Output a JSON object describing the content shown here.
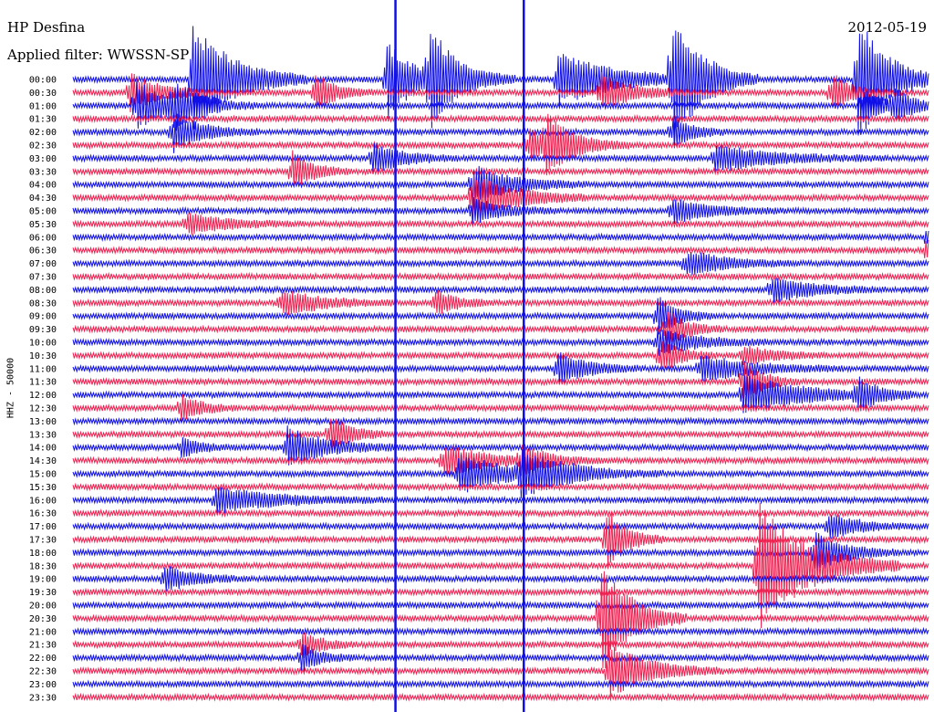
{
  "header": {
    "station": "HP Desfina",
    "filter": "Applied filter: WWSSN-SP",
    "date": "2012-05-19",
    "channel": "HHZ - 50000"
  },
  "chart_data": {
    "type": "helicorder",
    "title": "HP Desfina",
    "subtitle": "Applied filter: WWSSN-SP",
    "date": "2012-05-19",
    "ylabel": "HHZ - 50000",
    "row_interval_minutes": 30,
    "series_colors": [
      "#1010e6",
      "#ee2050"
    ],
    "rows": [
      "00:00",
      "00:30",
      "01:00",
      "01:30",
      "02:00",
      "02:30",
      "03:00",
      "03:30",
      "04:00",
      "04:30",
      "05:00",
      "05:30",
      "06:00",
      "06:30",
      "07:00",
      "07:30",
      "08:00",
      "08:30",
      "09:00",
      "09:30",
      "10:00",
      "10:30",
      "11:00",
      "11:30",
      "12:00",
      "12:30",
      "13:00",
      "13:30",
      "14:00",
      "14:30",
      "15:00",
      "15:30",
      "16:00",
      "16:30",
      "17:00",
      "17:30",
      "18:00",
      "18:30",
      "19:00",
      "19:30",
      "20:00",
      "20:30",
      "21:00",
      "21:30",
      "22:00",
      "22:30",
      "23:00",
      "23:30"
    ],
    "events": [
      {
        "row": "00:00",
        "minute": 4.2,
        "amplitude": 9,
        "duration": 4
      },
      {
        "row": "00:00",
        "minute": 11,
        "amplitude": 6,
        "duration": 3
      },
      {
        "row": "00:00",
        "minute": 12.5,
        "amplitude": 7,
        "duration": 3
      },
      {
        "row": "00:00",
        "minute": 21,
        "amplitude": 10,
        "duration": 3
      },
      {
        "row": "00:00",
        "minute": 17,
        "amplitude": 4,
        "duration": 6
      },
      {
        "row": "00:00",
        "minute": 27.5,
        "amplitude": 10,
        "duration": 3
      },
      {
        "row": "00:30",
        "minute": 2,
        "amplitude": 3,
        "duration": 3
      },
      {
        "row": "00:30",
        "minute": 8.5,
        "amplitude": 3,
        "duration": 2
      },
      {
        "row": "00:30",
        "minute": 18.5,
        "amplitude": 3,
        "duration": 3
      },
      {
        "row": "00:30",
        "minute": 26.6,
        "amplitude": 3,
        "duration": 2
      },
      {
        "row": "01:00",
        "minute": 2.2,
        "amplitude": 4,
        "duration": 3
      },
      {
        "row": "01:00",
        "minute": 3.5,
        "amplitude": 3,
        "duration": 3
      },
      {
        "row": "01:00",
        "minute": 27.7,
        "amplitude": 3,
        "duration": 2
      },
      {
        "row": "01:00",
        "minute": 28.8,
        "amplitude": 2.5,
        "duration": 2
      },
      {
        "row": "02:00",
        "minute": 3.5,
        "amplitude": 3,
        "duration": 3
      },
      {
        "row": "02:00",
        "minute": 21,
        "amplitude": 2.5,
        "duration": 2
      },
      {
        "row": "02:30",
        "minute": 16,
        "amplitude": 3,
        "duration": 2
      },
      {
        "row": "02:30",
        "minute": 16.6,
        "amplitude": 4,
        "duration": 3
      },
      {
        "row": "03:00",
        "minute": 10.5,
        "amplitude": 2.5,
        "duration": 3
      },
      {
        "row": "03:00",
        "minute": 22.5,
        "amplitude": 2,
        "duration": 6
      },
      {
        "row": "03:30",
        "minute": 7.7,
        "amplitude": 3,
        "duration": 2
      },
      {
        "row": "04:00",
        "minute": 14,
        "amplitude": 3,
        "duration": 4
      },
      {
        "row": "04:30",
        "minute": 14,
        "amplitude": 4,
        "duration": 4
      },
      {
        "row": "05:00",
        "minute": 14,
        "amplitude": 2,
        "duration": 3
      },
      {
        "row": "05:00",
        "minute": 21,
        "amplitude": 1.8,
        "duration": 4
      },
      {
        "row": "05:30",
        "minute": 4,
        "amplitude": 1.6,
        "duration": 4
      },
      {
        "row": "06:00",
        "minute": 30,
        "amplitude": 2.5,
        "duration": 3
      },
      {
        "row": "06:30",
        "minute": 30,
        "amplitude": 4,
        "duration": 3
      },
      {
        "row": "07:00",
        "minute": 21.5,
        "amplitude": 2,
        "duration": 4
      },
      {
        "row": "08:00",
        "minute": 24.5,
        "amplitude": 2,
        "duration": 4
      },
      {
        "row": "08:30",
        "minute": 7.3,
        "amplitude": 2,
        "duration": 4
      },
      {
        "row": "08:30",
        "minute": 12.7,
        "amplitude": 2,
        "duration": 2
      },
      {
        "row": "09:00",
        "minute": 20.5,
        "amplitude": 3,
        "duration": 2
      },
      {
        "row": "09:30",
        "minute": 20.8,
        "amplitude": 3,
        "duration": 2
      },
      {
        "row": "10:00",
        "minute": 20.5,
        "amplitude": 2,
        "duration": 4
      },
      {
        "row": "10:30",
        "minute": 20.6,
        "amplitude": 3,
        "duration": 2
      },
      {
        "row": "10:30",
        "minute": 23.5,
        "amplitude": 1.5,
        "duration": 3
      },
      {
        "row": "11:00",
        "minute": 17,
        "amplitude": 2.5,
        "duration": 3
      },
      {
        "row": "11:00",
        "minute": 22,
        "amplitude": 2,
        "duration": 5
      },
      {
        "row": "11:30",
        "minute": 23.5,
        "amplitude": 3,
        "duration": 2
      },
      {
        "row": "12:00",
        "minute": 23.5,
        "amplitude": 3,
        "duration": 6
      },
      {
        "row": "12:00",
        "minute": 27.5,
        "amplitude": 2.5,
        "duration": 2
      },
      {
        "row": "12:30",
        "minute": 3.8,
        "amplitude": 2,
        "duration": 2
      },
      {
        "row": "13:30",
        "minute": 9,
        "amplitude": 3,
        "duration": 2
      },
      {
        "row": "14:00",
        "minute": 7.5,
        "amplitude": 3,
        "duration": 4
      },
      {
        "row": "14:00",
        "minute": 3.8,
        "amplitude": 1.5,
        "duration": 2
      },
      {
        "row": "14:30",
        "minute": 13,
        "amplitude": 2.5,
        "duration": 4
      },
      {
        "row": "14:30",
        "minute": 15.7,
        "amplitude": 2,
        "duration": 3
      },
      {
        "row": "15:00",
        "minute": 13.5,
        "amplitude": 3,
        "duration": 5
      },
      {
        "row": "15:00",
        "minute": 15.7,
        "amplitude": 3,
        "duration": 5
      },
      {
        "row": "16:00",
        "minute": 5,
        "amplitude": 2,
        "duration": 6
      },
      {
        "row": "17:00",
        "minute": 26.5,
        "amplitude": 2,
        "duration": 3
      },
      {
        "row": "17:30",
        "minute": 18.7,
        "amplitude": 5,
        "duration": 2
      },
      {
        "row": "18:00",
        "minute": 26,
        "amplitude": 3,
        "duration": 3
      },
      {
        "row": "18:30",
        "minute": 24,
        "amplitude": 10,
        "duration": 5
      },
      {
        "row": "19:00",
        "minute": 3.2,
        "amplitude": 2,
        "duration": 3
      },
      {
        "row": "20:30",
        "minute": 18.5,
        "amplitude": 9,
        "duration": 3
      },
      {
        "row": "21:30",
        "minute": 8,
        "amplitude": 2,
        "duration": 2
      },
      {
        "row": "22:00",
        "minute": 8,
        "amplitude": 2,
        "duration": 2
      },
      {
        "row": "22:30",
        "minute": 18.8,
        "amplitude": 4,
        "duration": 4
      }
    ],
    "continuous_lines": [
      {
        "minute": 11.3,
        "color_index": 0
      },
      {
        "minute": 15.8,
        "color_index": 0
      }
    ]
  }
}
